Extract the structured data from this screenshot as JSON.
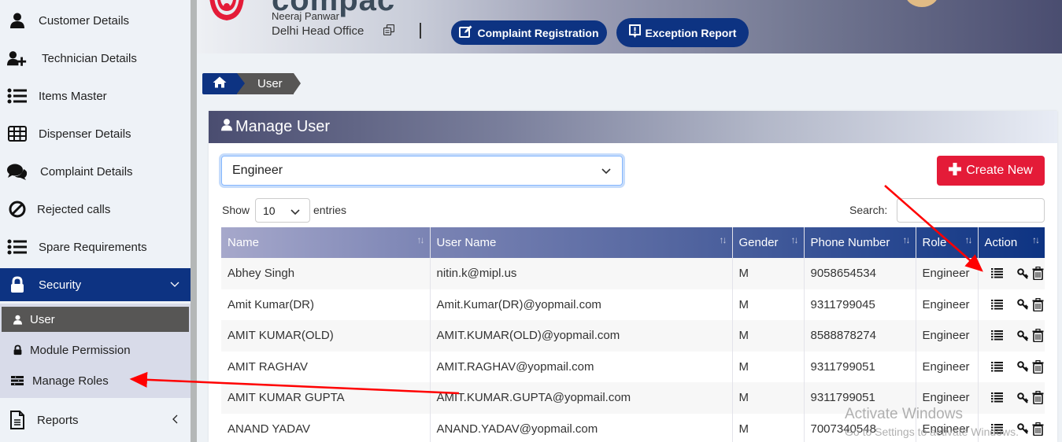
{
  "sidebar": {
    "items": [
      {
        "label": "Customer Details",
        "icon": "user-icon"
      },
      {
        "label": "Technician Details",
        "icon": "user-plus-icon"
      },
      {
        "label": "Items Master",
        "icon": "list-icon"
      },
      {
        "label": "Dispenser Details",
        "icon": "table-icon"
      },
      {
        "label": "Complaint Details",
        "icon": "comments-icon"
      },
      {
        "label": "Rejected calls",
        "icon": "ban-icon"
      },
      {
        "label": "Spare Requirements",
        "icon": "list-icon"
      },
      {
        "label": "Security",
        "icon": "lock-icon",
        "expanded": true
      },
      {
        "label": "Reports",
        "icon": "file-icon",
        "expanded": false
      }
    ],
    "security_submenu": [
      {
        "label": "User",
        "icon": "user-icon",
        "active": true
      },
      {
        "label": "Module Permission",
        "icon": "lock-icon"
      },
      {
        "label": "Manage Roles",
        "icon": "roles-icon"
      }
    ]
  },
  "header": {
    "logo_text": "compac",
    "user_name": "Neeraj Panwar",
    "office": "Delhi Head Office",
    "buttons": {
      "complaint_registration": "Complaint Registration",
      "exception_report": "Exception Report"
    }
  },
  "breadcrumb": {
    "home_icon": "home-icon",
    "current": "User"
  },
  "card": {
    "title": "Manage User",
    "role_filter": "Engineer",
    "create_button": "Create New",
    "show_label": "Show",
    "page_length": "10",
    "entries_label": "entries",
    "search_label": "Search:",
    "search_value": ""
  },
  "table": {
    "columns": [
      "Name",
      "User Name",
      "Gender",
      "Phone Number",
      "Role",
      "Action"
    ],
    "rows": [
      {
        "name": "Abhey Singh",
        "username": "nitin.k@mipl.us",
        "gender": "M",
        "phone": "9058654534",
        "role": "Engineer"
      },
      {
        "name": "Amit Kumar(DR)",
        "username": "Amit.Kumar(DR)@yopmail.com",
        "gender": "M",
        "phone": "9311799045",
        "role": "Engineer"
      },
      {
        "name": "AMIT KUMAR(OLD)",
        "username": "AMIT.KUMAR(OLD)@yopmail.com",
        "gender": "M",
        "phone": "8588878274",
        "role": "Engineer"
      },
      {
        "name": "AMIT RAGHAV",
        "username": "AMIT.RAGHAV@yopmail.com",
        "gender": "M",
        "phone": "9311799051",
        "role": "Engineer"
      },
      {
        "name": "AMIT KUMAR GUPTA",
        "username": "AMIT.KUMAR.GUPTA@yopmail.com",
        "gender": "M",
        "phone": "9311799051",
        "role": "Engineer"
      },
      {
        "name": "ANAND YADAV",
        "username": "ANAND.YADAV@yopmail.com",
        "gender": "M",
        "phone": "7007340548",
        "role": "Engineer"
      }
    ],
    "action_icons": [
      "list-icon",
      "key-icon",
      "trash-icon"
    ]
  },
  "watermark": {
    "line1": "Activate Windows",
    "line2": "Go to Settings to activate Windows."
  },
  "colors": {
    "primary": "#0d3382",
    "danger": "#e41b38",
    "annotation": "#ff0000"
  }
}
